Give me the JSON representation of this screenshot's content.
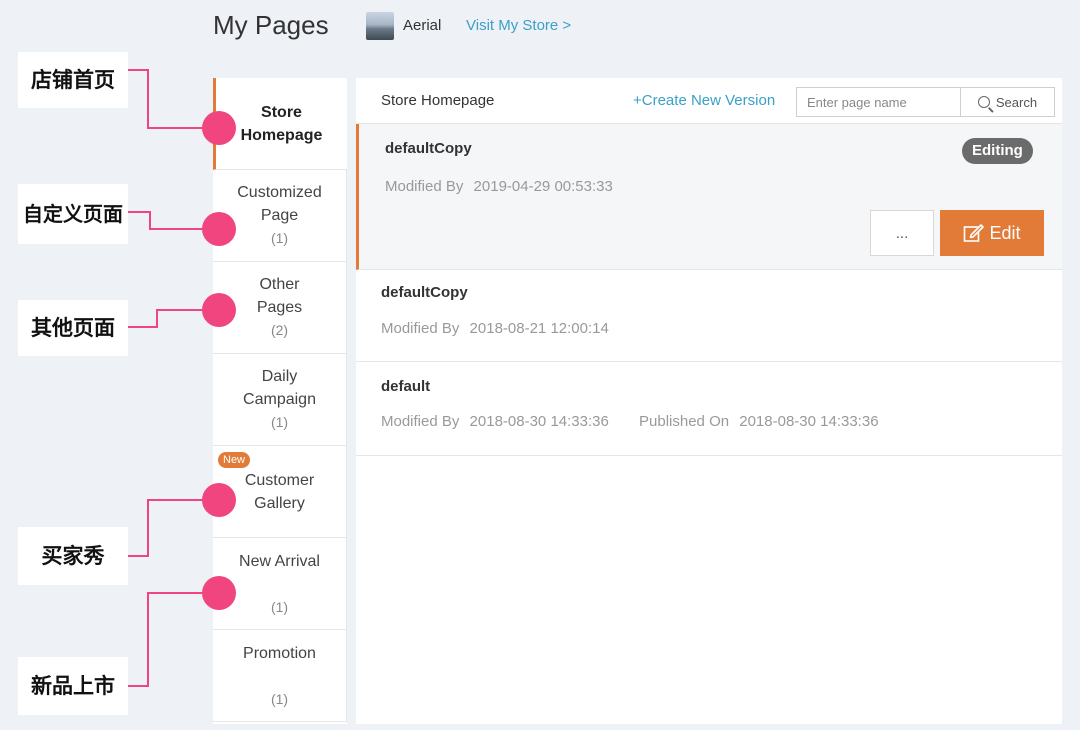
{
  "header": {
    "title": "My Pages",
    "store_name": "Aerial",
    "visit_link": "Visit My Store >"
  },
  "sidebar": {
    "items": [
      {
        "line1": "Store",
        "line2": "Homepage",
        "count": ""
      },
      {
        "line1": "Customized",
        "line2": "Page",
        "count": "(1)"
      },
      {
        "line1": "Other",
        "line2": "Pages",
        "count": "(2)"
      },
      {
        "line1": "Daily",
        "line2": "Campaign",
        "count": "(1)"
      },
      {
        "line1": "Customer",
        "line2": "Gallery",
        "count": "",
        "badge": "New"
      },
      {
        "line1": "New Arrival",
        "line2": "",
        "count": "(1)"
      },
      {
        "line1": "Promotion",
        "line2": "",
        "count": "(1)"
      }
    ]
  },
  "main": {
    "heading": "Store Homepage",
    "create_link": "+Create New Version",
    "search": {
      "placeholder": "Enter page name",
      "button_label": "Search"
    },
    "versions": [
      {
        "name": "defaultCopy",
        "modified_label": "Modified By",
        "modified": "2019-04-29 00:53:33",
        "status": "Editing",
        "more_label": "...",
        "edit_label": "Edit"
      },
      {
        "name": "defaultCopy",
        "modified_label": "Modified By",
        "modified": "2018-08-21 12:00:14"
      },
      {
        "name": "default",
        "modified_label": "Modified By",
        "modified": "2018-08-30 14:33:36",
        "published_label": "Published On",
        "published": "2018-08-30 14:33:36"
      }
    ]
  },
  "annotations": [
    {
      "text": "店铺首页"
    },
    {
      "text": "自定义页面"
    },
    {
      "text": "其他页面"
    },
    {
      "text": "买家秀"
    },
    {
      "text": "新品上市"
    }
  ],
  "colors": {
    "accent": "#e27b38",
    "link": "#3aa0c8",
    "annotation": "#f0457f"
  }
}
